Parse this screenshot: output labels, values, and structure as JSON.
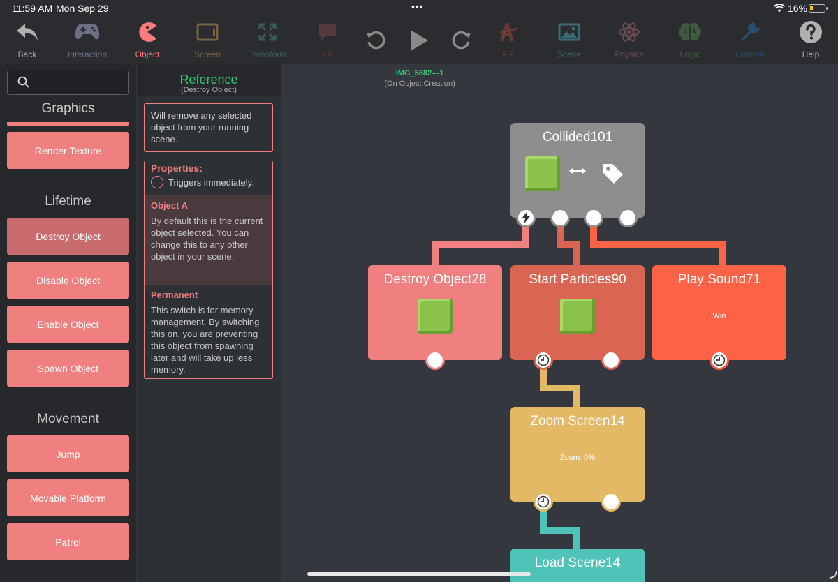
{
  "status": {
    "time": "11:59 AM",
    "date": "Mon Sep 29",
    "dots": "•••",
    "battery": "16%"
  },
  "toolbar": {
    "items": [
      {
        "label": "Back",
        "icon": "back-arrow-icon",
        "color": "#b0b0b0"
      },
      {
        "label": "Interaction",
        "icon": "gamepad-icon",
        "color": "#6c6f86"
      },
      {
        "label": "Object",
        "icon": "pacman-icon",
        "color": "#ff7b7b"
      },
      {
        "label": "Screen",
        "icon": "screen-icon",
        "color": "#7a6341"
      },
      {
        "label": "Transform",
        "icon": "transform-icon",
        "color": "#3b5c5a"
      },
      {
        "label": "UI",
        "icon": "speech-bubble-icon",
        "color": "#55393e"
      },
      {
        "label": "FX",
        "icon": "fx-icon",
        "color": "#6a3b34"
      },
      {
        "label": "Scene",
        "icon": "image-icon",
        "color": "#3c6a72"
      },
      {
        "label": "Physics",
        "icon": "atom-icon",
        "color": "#6b4a55"
      },
      {
        "label": "Logic",
        "icon": "brain-icon",
        "color": "#3f5a40"
      },
      {
        "label": "Custom",
        "icon": "wrench-icon",
        "color": "#2c4d6b"
      },
      {
        "label": "Help",
        "icon": "question-icon",
        "color": "#b0b0b0"
      }
    ]
  },
  "library": {
    "search_placeholder": "",
    "sections": [
      {
        "title": "Graphics"
      },
      {
        "title": "Lifetime"
      },
      {
        "title": "Movement"
      }
    ],
    "buttons": [
      {
        "label": "Render Texture"
      },
      {
        "label": "Destroy Object"
      },
      {
        "label": "Disable Object"
      },
      {
        "label": "Enable Object"
      },
      {
        "label": "Spawn Object"
      },
      {
        "label": "Jump"
      },
      {
        "label": "Movable Platform"
      },
      {
        "label": "Patrol"
      }
    ]
  },
  "reference": {
    "title": "Reference",
    "subtitle": "(Destroy Object)",
    "description": "Will remove any selected object from your running scene.",
    "properties_title": "Properties:",
    "trigger_text": "Triggers immediately.",
    "props": [
      {
        "name": "Object A",
        "text": "By default this is the current object selected. You can change this to any other object in your scene."
      },
      {
        "name": "Permanent",
        "text": "This switch is for memory management. By switching this on, you are preventing this object from spawning later and will take up less memory."
      }
    ]
  },
  "canvas": {
    "title": "IMG_5682---1",
    "subtitle": "(On Object Creation)",
    "nodes": {
      "collided": {
        "title": "Collided101",
        "color": "#8e8e8e"
      },
      "destroy": {
        "title": "Destroy Object28",
        "color": "#f08080"
      },
      "particles": {
        "title": "Start Particles90",
        "color": "#d96552"
      },
      "sound": {
        "title": "Play Sound71",
        "value": "Win",
        "color": "#ff6347"
      },
      "zoom": {
        "title": "Zoom Screen14",
        "value": "Zoom: 0%",
        "color": "#e4b965"
      },
      "load": {
        "title": "Load Scene14",
        "color": "#4fc3b7"
      }
    }
  }
}
